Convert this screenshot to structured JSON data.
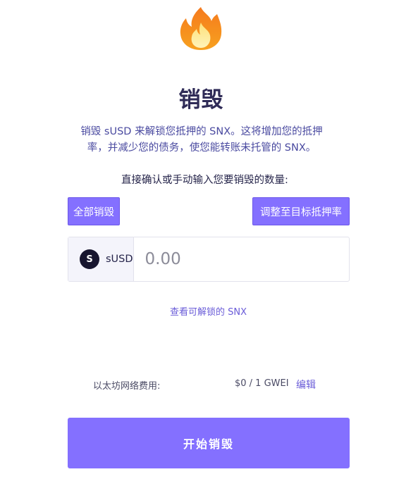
{
  "header": {
    "icon": "fire-icon",
    "title": "销毁"
  },
  "description": {
    "line1": "销毁 sUSD 来解锁您抵押的 SNX。这将增加您的抵押",
    "line2": "率，并减少您的债务，使您能转账未托管的 SNX。"
  },
  "prompt": "直接确认或手动输入您要销毁的数量:",
  "buttons": {
    "burn_all": "全部销毁",
    "adjust_target": "调整至目标抵押率",
    "start_burn": "开始销毁"
  },
  "amount": {
    "currency": "sUSD",
    "currency_logo_text": "S",
    "placeholder": "0.00",
    "value": ""
  },
  "view_unlockable": "查看可解锁的 SNX",
  "gas": {
    "label": "以太坊网络费用:",
    "value": "$0 / 1 GWEI",
    "edit_label": "编辑"
  },
  "colors": {
    "accent": "#8470ff",
    "link": "#6a5cd8",
    "title": "#2f2b57"
  }
}
